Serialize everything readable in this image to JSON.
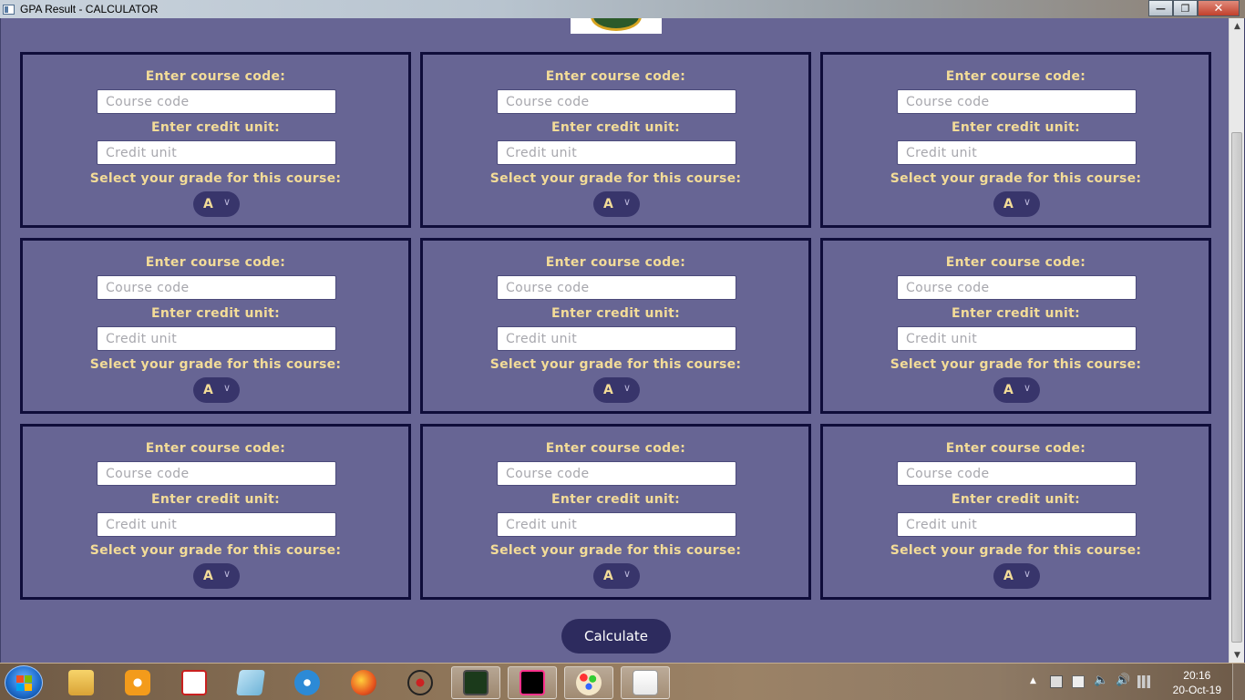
{
  "window": {
    "title": "GPA Result - CALCULATOR",
    "minimize_icon": "minimize-icon",
    "maximize_icon": "restore-icon",
    "close_icon": "close-icon"
  },
  "form": {
    "course_label": "Enter course code:",
    "course_placeholder": "Course code",
    "credit_label": "Enter credit unit:",
    "credit_placeholder": "Credit unit",
    "grade_label": "Select your grade for this course:",
    "grade_value": "A",
    "cards": [
      {
        "id": 1
      },
      {
        "id": 2
      },
      {
        "id": 3
      },
      {
        "id": 4
      },
      {
        "id": 5
      },
      {
        "id": 6
      },
      {
        "id": 7
      },
      {
        "id": 8
      },
      {
        "id": 9
      }
    ]
  },
  "calculate_label": "Calculate",
  "colors": {
    "background": "#676594",
    "label": "#f3dc98",
    "card_border": "#0f0d3a",
    "button": "#2d2b5e"
  },
  "taskbar": {
    "icons": [
      "start-button",
      "file-explorer-icon",
      "uc-browser-icon",
      "pdf-reader-icon",
      "notepad-icon",
      "network-icon",
      "firefox-icon",
      "spider-icon",
      "terminal-icon",
      "intellij-icon",
      "paint-icon",
      "java-icon"
    ],
    "clock": {
      "time": "20:16",
      "date": "20-Oct-19"
    }
  }
}
